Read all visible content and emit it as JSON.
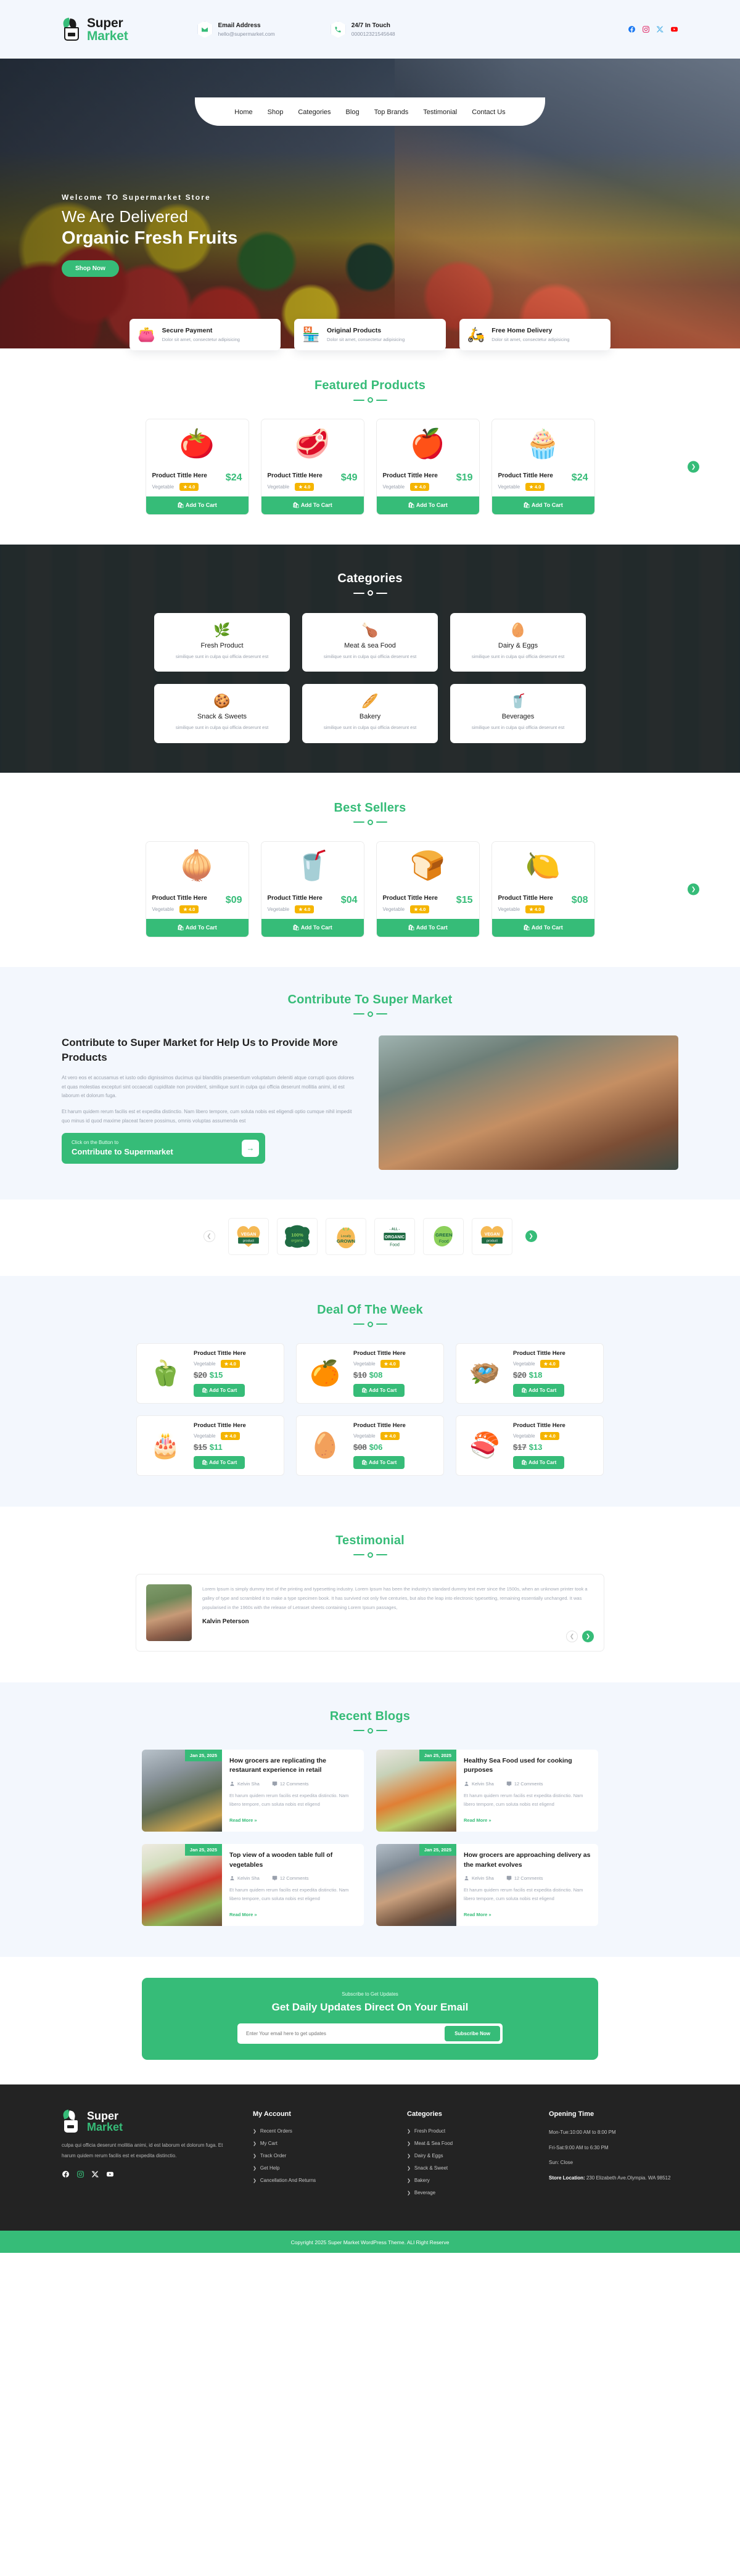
{
  "brand": {
    "name_part1": "Super",
    "name_part2": "Market"
  },
  "topbar": {
    "email_label": "Email Address",
    "email_value": "hello@supermarket.com",
    "phone_label": "24/7 In Touch",
    "phone_value": "000012321545648",
    "socials": [
      "facebook-icon",
      "instagram-icon",
      "x-twitter-icon",
      "youtube-icon"
    ]
  },
  "nav": {
    "items": [
      {
        "label": "Home",
        "active": true
      },
      {
        "label": "Shop",
        "active": false
      },
      {
        "label": "Categories",
        "active": false
      },
      {
        "label": "Blog",
        "active": false
      },
      {
        "label": "Top Brands",
        "active": false
      },
      {
        "label": "Testimonial",
        "active": false
      },
      {
        "label": "Contact Us",
        "active": false
      }
    ]
  },
  "hero": {
    "welcome": "Welcome TO Supermarket Store",
    "line1": "We Are Delivered",
    "line2": "Organic Fresh Fruits",
    "cta": "Shop Now"
  },
  "features": [
    {
      "icon": "wallet-icon",
      "emoji": "👛",
      "title": "Secure Payment",
      "subtitle": "Dolor sit amet, consectetur adipisicing"
    },
    {
      "icon": "store-icon",
      "emoji": "🏪",
      "title": "Original Products",
      "subtitle": "Dolor sit amet, consectetur adipisicing"
    },
    {
      "icon": "scooter-delivery-icon",
      "emoji": "🛵",
      "title": "Free Home Delivery",
      "subtitle": "Dolor sit amet, consectetur adipisicing"
    }
  ],
  "featured": {
    "title": "Featured Products",
    "products": [
      {
        "emoji": "🍅",
        "name": "Product Tittle  Here",
        "category": "Vegetable",
        "rating": "4.0",
        "price": "$24",
        "cart": "Add To Cart"
      },
      {
        "emoji": "🥩",
        "name": "Product Tittle  Here",
        "category": "Vegetable",
        "rating": "4.0",
        "price": "$49",
        "cart": "Add To Cart"
      },
      {
        "emoji": "🍎",
        "name": "Product Tittle  Here",
        "category": "Vegetable",
        "rating": "4.0",
        "price": "$19",
        "cart": "Add To Cart"
      },
      {
        "emoji": "🧁",
        "name": "Product Tittle  Here",
        "category": "Vegetable",
        "rating": "4.0",
        "price": "$24",
        "cart": "Add To Cart"
      }
    ]
  },
  "categories": {
    "title": "Categories",
    "items": [
      {
        "emoji": "🌿",
        "name": "Fresh Product",
        "desc": "similique sunt in culpa qui officia deserunt est"
      },
      {
        "emoji": "🍗",
        "name": "Meat & sea Food",
        "desc": "similique sunt in culpa qui officia deserunt est"
      },
      {
        "emoji": "🥚",
        "name": "Dairy & Eggs",
        "desc": "similique sunt in culpa qui officia deserunt est"
      },
      {
        "emoji": "🍪",
        "name": "Snack & Sweets",
        "desc": "similique sunt in culpa qui officia deserunt est"
      },
      {
        "emoji": "🥖",
        "name": "Bakery",
        "desc": "similique sunt in culpa qui officia deserunt est"
      },
      {
        "emoji": "🥤",
        "name": "Beverages",
        "desc": "similique sunt in culpa qui officia deserunt est"
      }
    ]
  },
  "bestsellers": {
    "title": "Best Sellers",
    "products": [
      {
        "emoji": "🧅",
        "name": "Product Tittle  Here",
        "category": "Vegetable",
        "rating": "4.0",
        "price": "$09",
        "cart": "Add To Cart"
      },
      {
        "emoji": "🥤",
        "name": "Product Tittle  Here",
        "category": "Vegetable",
        "rating": "4.0",
        "price": "$04",
        "cart": "Add To Cart"
      },
      {
        "emoji": "🍞",
        "name": "Product Tittle  Here",
        "category": "Vegetable",
        "rating": "4.0",
        "price": "$15",
        "cart": "Add To Cart"
      },
      {
        "emoji": "🍋",
        "name": "Product Tittle  Here",
        "category": "Vegetable",
        "rating": "4.0",
        "price": "$08",
        "cart": "Add To Cart"
      }
    ]
  },
  "contribute": {
    "title": "Contribute To Super Market",
    "heading": "Contribute to Super Market for Help Us to Provide More Products",
    "para1": "At vero eos et accusamus et iusto odio dignissimos ducimus qui blanditiis praesentium voluptatum deleniti atque corrupti quos dolores et quas molestias excepturi sint occaecati cupiditate non provident, similique sunt in culpa qui officia deserunt mollitia animi, id est laborum et dolorum fuga.",
    "para2": "Et harum quidem rerum facilis est et expedita distinctio. Nam libero tempore, cum soluta nobis est eligendi optio cumque nihil impedit quo minus id quod maxime placeat facere possimus, omnis voluptas assumenda est",
    "btn_small": "Click on the Button to",
    "btn_big": "Contribute to Supermarket"
  },
  "brands": [
    {
      "name": "vegan-product-badge",
      "line1": "VEGAN",
      "line2": "product"
    },
    {
      "name": "go-100-organic-badge",
      "line1": "100%",
      "line2": "organic"
    },
    {
      "name": "locally-grown-badge",
      "line1": "Locally",
      "line2": "GROWN"
    },
    {
      "name": "all-organic-food-badge",
      "line1": "ORGANIC",
      "line2": "Food"
    },
    {
      "name": "green-food-badge",
      "line1": "GREEN",
      "line2": "Food"
    },
    {
      "name": "vegan-product-badge-2",
      "line1": "VEGAN",
      "line2": "product"
    }
  ],
  "deal": {
    "title": "Deal Of The Week",
    "items": [
      {
        "emoji": "🫑",
        "name": "Product Tittle  Here",
        "category": "Vegetable",
        "rating": "4.0",
        "old": "$20",
        "new": "$15",
        "cart": "Add To Cart"
      },
      {
        "emoji": "🍊",
        "name": "Product Tittle  Here",
        "category": "Vegetable",
        "rating": "4.0",
        "old": "$10",
        "new": "$08",
        "cart": "Add To Cart"
      },
      {
        "emoji": "🪺",
        "name": "Product Tittle  Here",
        "category": "Vegetable",
        "rating": "4.0",
        "old": "$20",
        "new": "$18",
        "cart": "Add To Cart"
      },
      {
        "emoji": "🎂",
        "name": "Product Tittle  Here",
        "category": "Vegetable",
        "rating": "4.0",
        "old": "$15",
        "new": "$11",
        "cart": "Add To Cart"
      },
      {
        "emoji": "🥚",
        "name": "Product Tittle  Here",
        "category": "Vegetable",
        "rating": "4.0",
        "old": "$08",
        "new": "$06",
        "cart": "Add To Cart"
      },
      {
        "emoji": "🍣",
        "name": "Product Tittle  Here",
        "category": "Vegetable",
        "rating": "4.0",
        "old": "$17",
        "new": "$13",
        "cart": "Add To Cart"
      }
    ]
  },
  "testimonial": {
    "title": "Testimonial",
    "quote": "Lorem Ipsum is simply dummy text of the printing and typesetting industry. Lorem Ipsum has been the industry's standard dummy text ever since the 1500s, when an unknown printer took a galley of type and scrambled it to make a type specimen book. It has survived not only five centuries, but also the leap into electronic typesetting, remaining essentially unchanged. It was popularised in the 1960s with the release of Letraset sheets containing Lorem Ipsum passages,",
    "author": "Kalvin Peterson"
  },
  "blogs": {
    "title": "Recent Blogs",
    "posts": [
      {
        "date": "Jan 25, 2025",
        "title": "How grocers are replicating the restaurant experience in retail",
        "author": "Kelvin Sha",
        "comments": "12 Comments",
        "excerpt": "Et harum quidem rerum facilis est expedita distinctio. Nam libero tempore, cum soluta nobis est eligend",
        "more": "Read More »"
      },
      {
        "date": "Jan 25, 2025",
        "title": "Healthy Sea Food used for cooking purposes",
        "author": "Kelvin Sha",
        "comments": "12 Comments",
        "excerpt": "Et harum quidem rerum facilis est expedita distinctio. Nam libero tempore, cum soluta nobis est eligend",
        "more": "Read More »"
      },
      {
        "date": "Jan 25, 2025",
        "title": "Top view of a wooden table full of vegetables",
        "author": "Kelvin Sha",
        "comments": "12 Comments",
        "excerpt": "Et harum quidem rerum facilis est expedita distinctio. Nam libero tempore, cum soluta nobis est eligend",
        "more": "Read More »"
      },
      {
        "date": "Jan 25, 2025",
        "title": "How grocers are approaching delivery as the market evolves",
        "author": "Kelvin Sha",
        "comments": "12 Comments",
        "excerpt": "Et harum quidem rerum facilis est expedita distinctio. Nam libero tempore, cum soluta nobis est eligend",
        "more": "Read More »"
      }
    ]
  },
  "newsletter": {
    "sub": "Subscribe to Get Updates",
    "heading": "Get Daily Updates Direct On Your Email",
    "placeholder": "Enter Your email here to get updates",
    "button": "Subscribe Now"
  },
  "footer": {
    "desc": "culpa qui officia deserunt mollitia animi, id est laborum et dolorum fuga. Et harum quidem rerum facilis est et expedita distinctio.",
    "socials": [
      "facebook-icon",
      "instagram-icon",
      "x-twitter-icon",
      "youtube-icon"
    ],
    "account": {
      "heading": "My Account",
      "items": [
        "Recent Orders",
        "My Cart",
        "Track Order",
        "Get Help",
        "Cancellation And Returns"
      ]
    },
    "categories": {
      "heading": "Categories",
      "items": [
        "Fresh Product",
        "Meat &  Sea Food",
        "Dairy & Eggs",
        "Snack & Sweet",
        "Bakery",
        "Beverage"
      ]
    },
    "opening": {
      "heading": "Opening Time",
      "rows": [
        "Mon-Tue:10:00 AM to 8:00 PM",
        "Fri-Sat:9:00 AM to 6:30 PM",
        "Sun: Close"
      ],
      "store_label": "Store Location:",
      "store_value": "230 Elizabeth Ave.Olympia. WA 98512"
    },
    "copyright": "Copyright 2025  Super Market WordPress Theme. ALl Right Reserve"
  },
  "colors": {
    "brand_green": "#36bc78",
    "dark": "#232323",
    "light_bg": "#f3f7fd",
    "star_gold": "#f5b500"
  }
}
